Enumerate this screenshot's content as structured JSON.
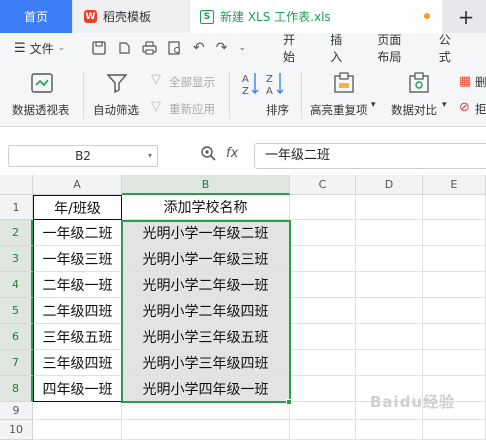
{
  "tabs": {
    "home": "首页",
    "template": "稻壳模板",
    "file": "新建 XLS 工作表.xls",
    "plus": "+"
  },
  "menu": {
    "file_label": "文件",
    "tabs": [
      "开始",
      "插入",
      "页面布局",
      "公式"
    ]
  },
  "ribbon": {
    "pivot": "数据透视表",
    "auto_filter": "自动筛选",
    "show_all": "全部显示",
    "reapply": "重新应用",
    "sort": "排序",
    "highlight_dup": "高亮重复项",
    "data_compare": "数据对比",
    "truncated1": "删",
    "truncated2": "拒"
  },
  "formula_bar": {
    "name_box": "B2",
    "fx": "fx",
    "content": "一年级二班"
  },
  "sheet": {
    "columns": [
      "A",
      "B",
      "C",
      "D",
      "E"
    ],
    "row_numbers": [
      "1",
      "2",
      "3",
      "4",
      "5",
      "6",
      "7",
      "8",
      "9",
      "10"
    ],
    "header": [
      "年/班级",
      "添加学校名称"
    ],
    "rows": [
      [
        "一年级二班",
        "光明小学一年级二班"
      ],
      [
        "一年级三班",
        "光明小学一年级三班"
      ],
      [
        "二年级一班",
        "光明小学二年级一班"
      ],
      [
        "二年级四班",
        "光明小学二年级四班"
      ],
      [
        "三年级五班",
        "光明小学三年级五班"
      ],
      [
        "三年级四班",
        "光明小学三年级四班"
      ],
      [
        "四年级一班",
        "光明小学四年级一班"
      ]
    ]
  },
  "colors": {
    "accent_blue": "#3c7ef7",
    "selection_green": "#2e9a4f",
    "tab_dot": "#f59a2b"
  },
  "icons": [
    "wps-template-icon",
    "spreadsheet-icon",
    "save-icon",
    "print-icon",
    "undo-icon",
    "redo-icon",
    "pivot-icon",
    "filter-icon",
    "sort-icon",
    "zoom-icon"
  ]
}
